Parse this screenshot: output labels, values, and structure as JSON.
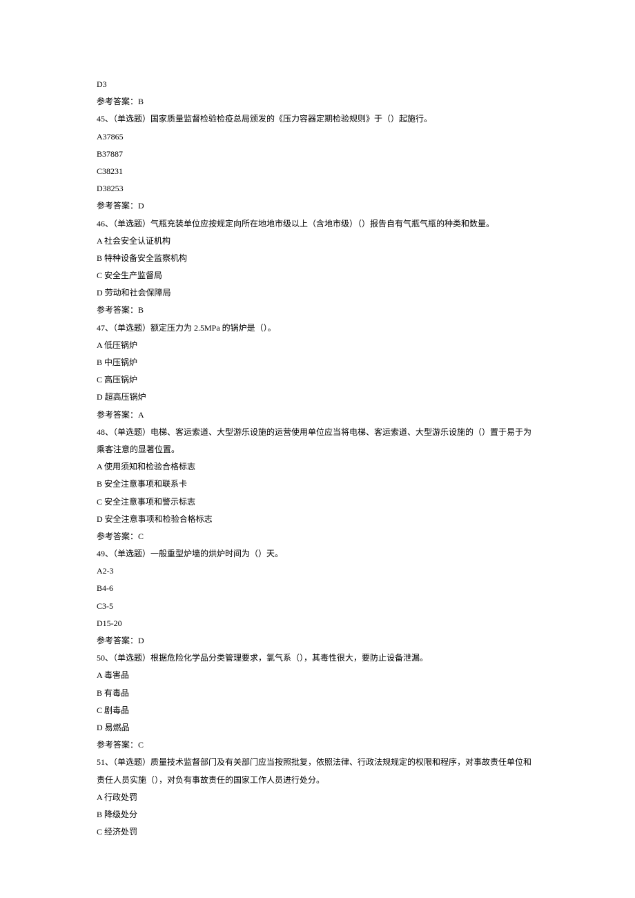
{
  "lines": [
    "D3",
    "参考答案：B",
    "45、（单选题）国家质量监督检验检疫总局颁发的《压力容器定期检验规则》于（）起施行。",
    "A37865",
    "B37887",
    "C38231",
    "D38253",
    "参考答案：D",
    "46、（单选题）气瓶充装单位应按规定向所在地地市级以上（含地市级）（）报告自有气瓶气瓶的种类和数量。",
    "A 社会安全认证机构",
    "B 特种设备安全监察机构",
    "C 安全生产监督局",
    "D 劳动和社会保障局",
    "参考答案：B",
    "47、（单选题）额定压力为 2.5MPa 的锅炉是（）。",
    "A 低压锅炉",
    "B 中压锅炉",
    "C 高压锅炉",
    "D 超高压锅炉",
    "参考答案：A",
    "48、（单选题）电梯、客运索道、大型游乐设施的运营使用单位应当将电梯、客运索道、大型游乐设施的（）置于易于为乘客注意的显著位置。",
    "A 使用须知和检验合格标志",
    "B 安全注意事项和联系卡",
    "C 安全注意事项和警示标志",
    "D 安全注意事项和检验合格标志",
    "参考答案：C",
    "49、（单选题）一般重型炉墙的烘炉时间为（）天。",
    "A2-3",
    "B4-6",
    "C3-5",
    "D15-20",
    "参考答案：D",
    "50、（单选题）根据危险化学品分类管理要求，氯气系（），其毒性很大，要防止设备泄漏。",
    "A 毒害品",
    "B 有毒品",
    "C 剧毒品",
    "D 易燃品",
    "参考答案：C",
    "51、（单选题）质量技术监督部门及有关部门应当按照批复，依照法律、行政法规规定的权限和程序，对事故责任单位和责任人员实施（），对负有事故责任的国家工作人员进行处分。",
    "A 行政处罚",
    "B 降级处分",
    "C 经济处罚"
  ]
}
